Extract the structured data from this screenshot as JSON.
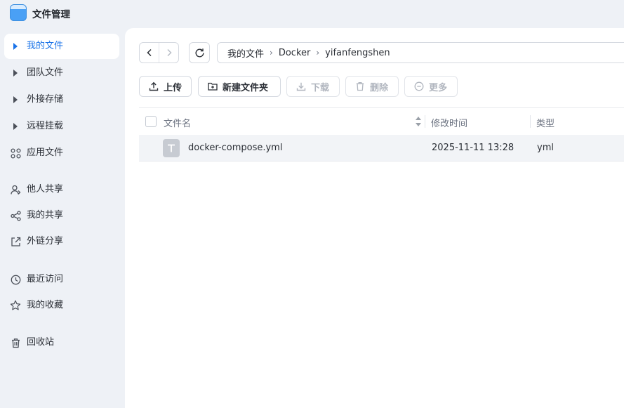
{
  "app": {
    "title": "文件管理"
  },
  "sidebar": {
    "items": [
      {
        "label": "我的文件",
        "icon": "triangle-right-icon",
        "active": true
      },
      {
        "label": "团队文件",
        "icon": "triangle-right-icon"
      },
      {
        "label": "外接存储",
        "icon": "triangle-right-icon"
      },
      {
        "label": "远程挂载",
        "icon": "triangle-right-icon"
      },
      {
        "label": "应用文件",
        "icon": "grid-apps-icon"
      },
      {
        "label": "他人共享",
        "icon": "person-share-icon"
      },
      {
        "label": "我的共享",
        "icon": "share-nodes-icon"
      },
      {
        "label": "外链分享",
        "icon": "external-link-icon"
      },
      {
        "label": "最近访问",
        "icon": "clock-icon"
      },
      {
        "label": "我的收藏",
        "icon": "star-icon"
      },
      {
        "label": "回收站",
        "icon": "trash-icon"
      }
    ]
  },
  "breadcrumb": [
    "我的文件",
    "Docker",
    "yifanfengshen"
  ],
  "toolbar": {
    "upload": "上传",
    "new_folder": "新建文件夹",
    "download": "下载",
    "delete": "删除",
    "more": "更多"
  },
  "table": {
    "headers": {
      "name": "文件名",
      "modified": "修改时间",
      "type": "类型"
    },
    "rows": [
      {
        "name": "docker-compose.yml",
        "modified": "2025-11-11 13:28",
        "type": "yml",
        "icon": "text-file-icon"
      }
    ]
  },
  "colors": {
    "accent": "#1a73e8",
    "sidebar_bg": "#eef1f6",
    "row_hover": "#f2f4f7"
  }
}
